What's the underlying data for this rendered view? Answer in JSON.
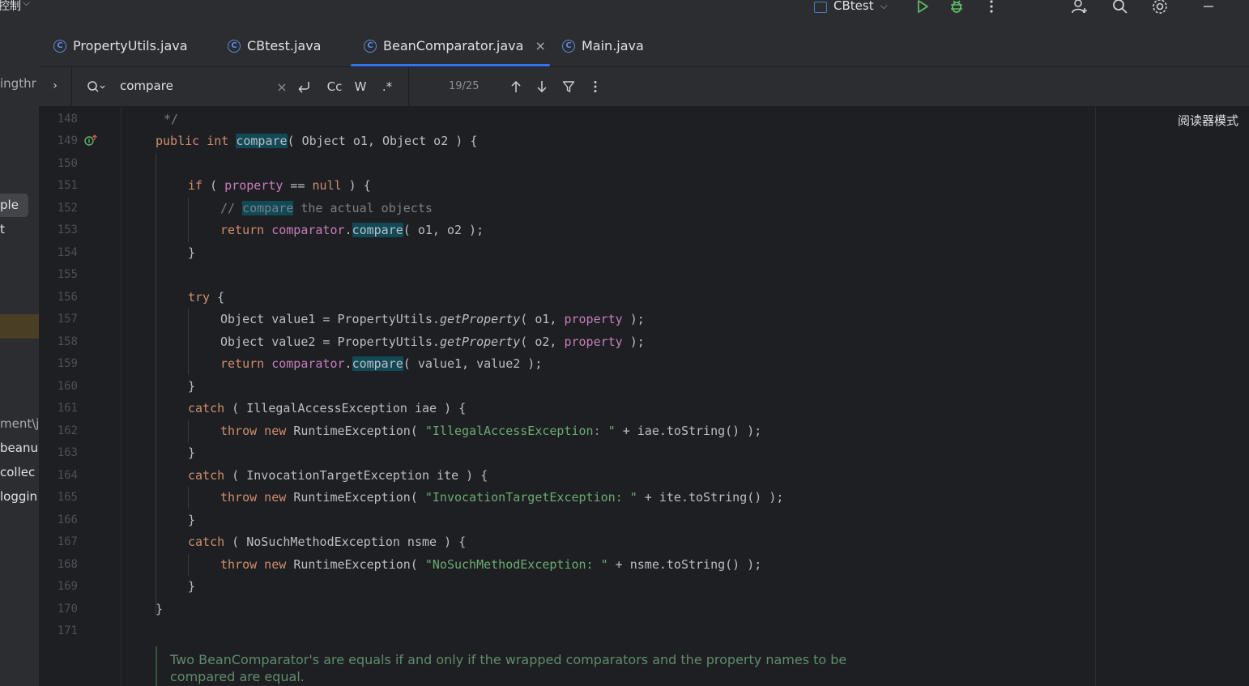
{
  "titlebar": {
    "left_label": "控制",
    "run_config": "CBtest",
    "icons": [
      "run-icon",
      "debug-icon",
      "more-vert-icon",
      "add-user-icon",
      "search-icon",
      "settings-icon",
      "minimize-icon"
    ]
  },
  "left_strip": {
    "items": [
      "ingthr",
      "ple",
      "t",
      "ment\\j",
      "beanu",
      "collec",
      "loggin"
    ]
  },
  "tabs": [
    {
      "label": "PropertyUtils.java",
      "active": false
    },
    {
      "label": "CBtest.java",
      "active": false
    },
    {
      "label": "BeanComparator.java",
      "active": true
    },
    {
      "label": "Main.java",
      "active": false
    }
  ],
  "search": {
    "query": "compare",
    "match_count": "19/25",
    "options": {
      "case": "Cc",
      "words": "W",
      "regex": ".*"
    }
  },
  "editor": {
    "reader_mode_label": "阅读器模式",
    "line_numbers": [
      "148",
      "149",
      "150",
      "151",
      "152",
      "153",
      "154",
      "155",
      "156",
      "157",
      "158",
      "159",
      "160",
      "161",
      "162",
      "163",
      "164",
      "165",
      "166",
      "167",
      "168",
      "169",
      "170",
      "171"
    ],
    "lines": {
      "l148": "*/",
      "l149_a": "public int ",
      "l149_b": "compare",
      "l149_c": "( Object o1, Object o2 ) {",
      "l151_a": "if",
      "l151_b": " ( ",
      "l151_c": "property",
      "l151_d": " == ",
      "l151_e": "null",
      "l151_f": " ) {",
      "l152_a": "// ",
      "l152_b": "compare",
      "l152_c": " the actual objects",
      "l153_a": "return ",
      "l153_b": "comparator",
      "l153_c": ".",
      "l153_d": "compare",
      "l153_e": "( o1, o2 );",
      "l154": "}",
      "l156_a": "try",
      "l156_b": " {",
      "l157_a": "Object value1 = PropertyUtils.",
      "l157_b": "getProperty",
      "l157_c": "( o1, ",
      "l157_d": "property",
      "l157_e": " );",
      "l158_a": "Object value2 = PropertyUtils.",
      "l158_b": "getProperty",
      "l158_c": "( o2, ",
      "l158_d": "property",
      "l158_e": " );",
      "l159_a": "return ",
      "l159_b": "comparator",
      "l159_c": ".",
      "l159_d": "compare",
      "l159_e": "( value1, value2 );",
      "l160": "}",
      "l161_a": "catch",
      "l161_b": " ( IllegalAccessException iae ) {",
      "l162_a": "throw new ",
      "l162_b": "RuntimeException( ",
      "l162_c": "\"IllegalAccessException: \"",
      "l162_d": " + iae.toString() );",
      "l163": "}",
      "l164_a": "catch",
      "l164_b": " ( InvocationTargetException ite ) {",
      "l165_a": "throw new ",
      "l165_b": "RuntimeException( ",
      "l165_c": "\"InvocationTargetException: \"",
      "l165_d": " + ite.toString() );",
      "l166": "}",
      "l167_a": "catch",
      "l167_b": " ( NoSuchMethodException nsme ) {",
      "l168_a": "throw new ",
      "l168_b": "RuntimeException( ",
      "l168_c": "\"NoSuchMethodException: \"",
      "l168_d": " + nsme.toString() );",
      "l169": "}",
      "l170": "}"
    },
    "doc_comment": "Two BeanComparator's are equals if and only if the wrapped comparators and the property names to be compared are equal."
  },
  "colors": {
    "accent": "#3574f0",
    "keyword": "#cf8e6d",
    "string": "#6aab73",
    "field": "#c77dbb",
    "search_highlight": "#114957"
  }
}
